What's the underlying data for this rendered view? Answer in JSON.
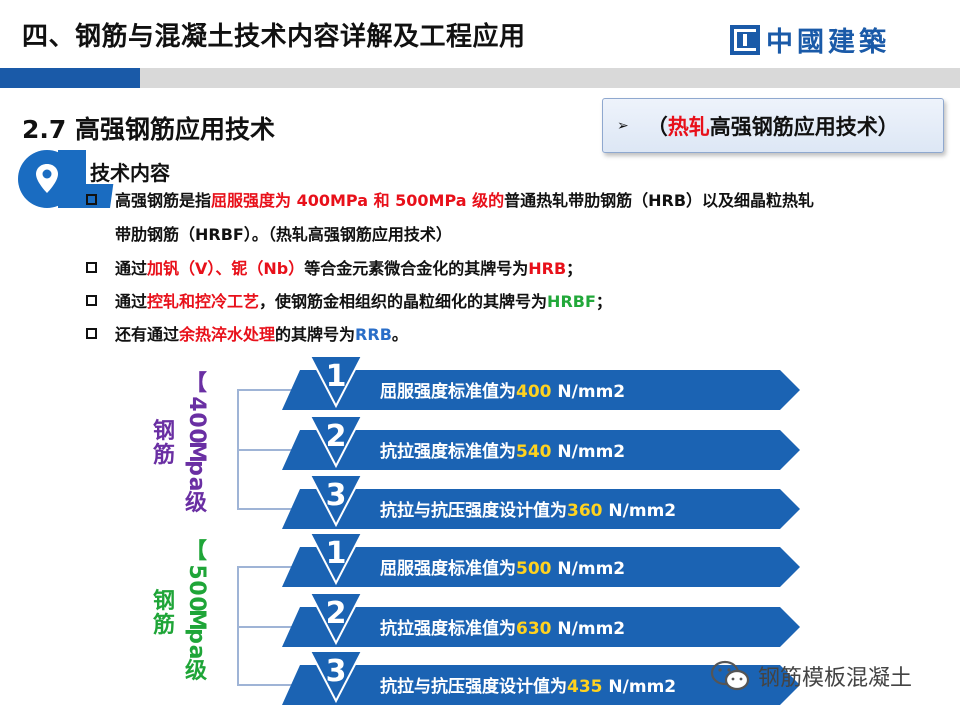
{
  "header": {
    "title": "四、钢筋与混凝土技术内容详解及工程应用",
    "logo_text": "中國建築"
  },
  "section": {
    "title": "2.7 高强钢筋应用技术"
  },
  "callout": {
    "prefix": "（",
    "highlight": "热轧",
    "rest": "高强钢筋应用技术",
    "suffix": "）"
  },
  "tech": {
    "label": "技术内容"
  },
  "bullets": [
    {
      "a": "高强钢筋是指",
      "b": "屈服强度为 400MPa 和 500MPa 级的",
      "c": "普通热轧带肋钢筋（HRB）以及细晶粒热轧"
    },
    {
      "cont": "带肋钢筋（HRBF）。（热轧高强钢筋应用技术）"
    },
    {
      "a": "通过",
      "b": "加钒（V）、铌（Nb）",
      "c": "等合金元素微合金化的其牌号为",
      "d": "HRB",
      "e": "；"
    },
    {
      "a": "通过",
      "b": "控轧和控冷工艺",
      "c": "，使钢筋金相组织的晶粒细化的其牌号为",
      "d": "HRBF",
      "e": "；"
    },
    {
      "a": "还有通过",
      "b": "余热淬水处理",
      "c": "的其牌号为",
      "d": "RRB",
      "e": "。"
    }
  ],
  "groups": [
    {
      "label_main": "钢筋",
      "label_grade": "【400Mpa级",
      "color": "#6a2fa3",
      "rows": [
        {
          "num": "1",
          "text": "屈服强度标准值为",
          "value": "400",
          "unit": " N/mm2"
        },
        {
          "num": "2",
          "text": "抗拉强度标准值为",
          "value": "540",
          "unit": " N/mm2"
        },
        {
          "num": "3",
          "text": "抗拉与抗压强度设计值为",
          "value": "360",
          "unit": " N/mm2"
        }
      ]
    },
    {
      "label_main": "钢筋",
      "label_grade": "【500Mpa级",
      "color": "#1fa538",
      "rows": [
        {
          "num": "1",
          "text": "屈服强度标准值为",
          "value": "500",
          "unit": " N/mm2"
        },
        {
          "num": "2",
          "text": "抗拉强度标准值为",
          "value": "630",
          "unit": " N/mm2"
        },
        {
          "num": "3",
          "text": "抗拉与抗压强度设计值为",
          "value": "435",
          "unit": " N/mm2"
        }
      ]
    }
  ],
  "colors": {
    "brand_blue": "#1a5aa8",
    "banner_blue": "#1b63b3",
    "value_yellow": "#ffd21f",
    "red": "#e8101a",
    "green": "#22a83a",
    "blue": "#2a6ec8"
  },
  "watermark": {
    "text": "钢筋模板混凝土",
    "icon": "wechat-icon"
  }
}
